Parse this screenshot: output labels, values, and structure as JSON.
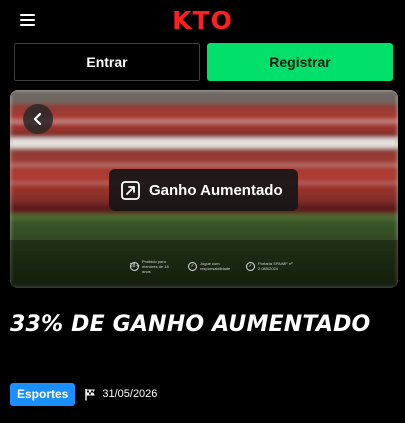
{
  "header": {
    "logo": "KTO",
    "menu_icon": "hamburger-menu-icon"
  },
  "auth": {
    "login_label": "Entrar",
    "register_label": "Registrar"
  },
  "banner": {
    "back_icon": "chevron-left-icon",
    "promo_icon": "arrow-up-right-box-icon",
    "promo_label": "Ganho Aumentado",
    "disclaimers": [
      {
        "icon": "18+",
        "text": "Proibido para menores de 18 anos"
      },
      {
        "icon": "✓",
        "text": "Jogue com responsabilidade"
      },
      {
        "icon": "✓",
        "text": "Portaria SPA/MF nº 2.085/2024"
      }
    ]
  },
  "article": {
    "title": "33% DE GANHO AUMENTADO",
    "category": "Esportes",
    "flag_icon": "checkered-flag-icon",
    "date": "31/05/2026"
  },
  "colors": {
    "brand_red": "#ff1f1f",
    "register_green": "#00e06a",
    "category_blue": "#1b8fff",
    "background": "#000000"
  }
}
